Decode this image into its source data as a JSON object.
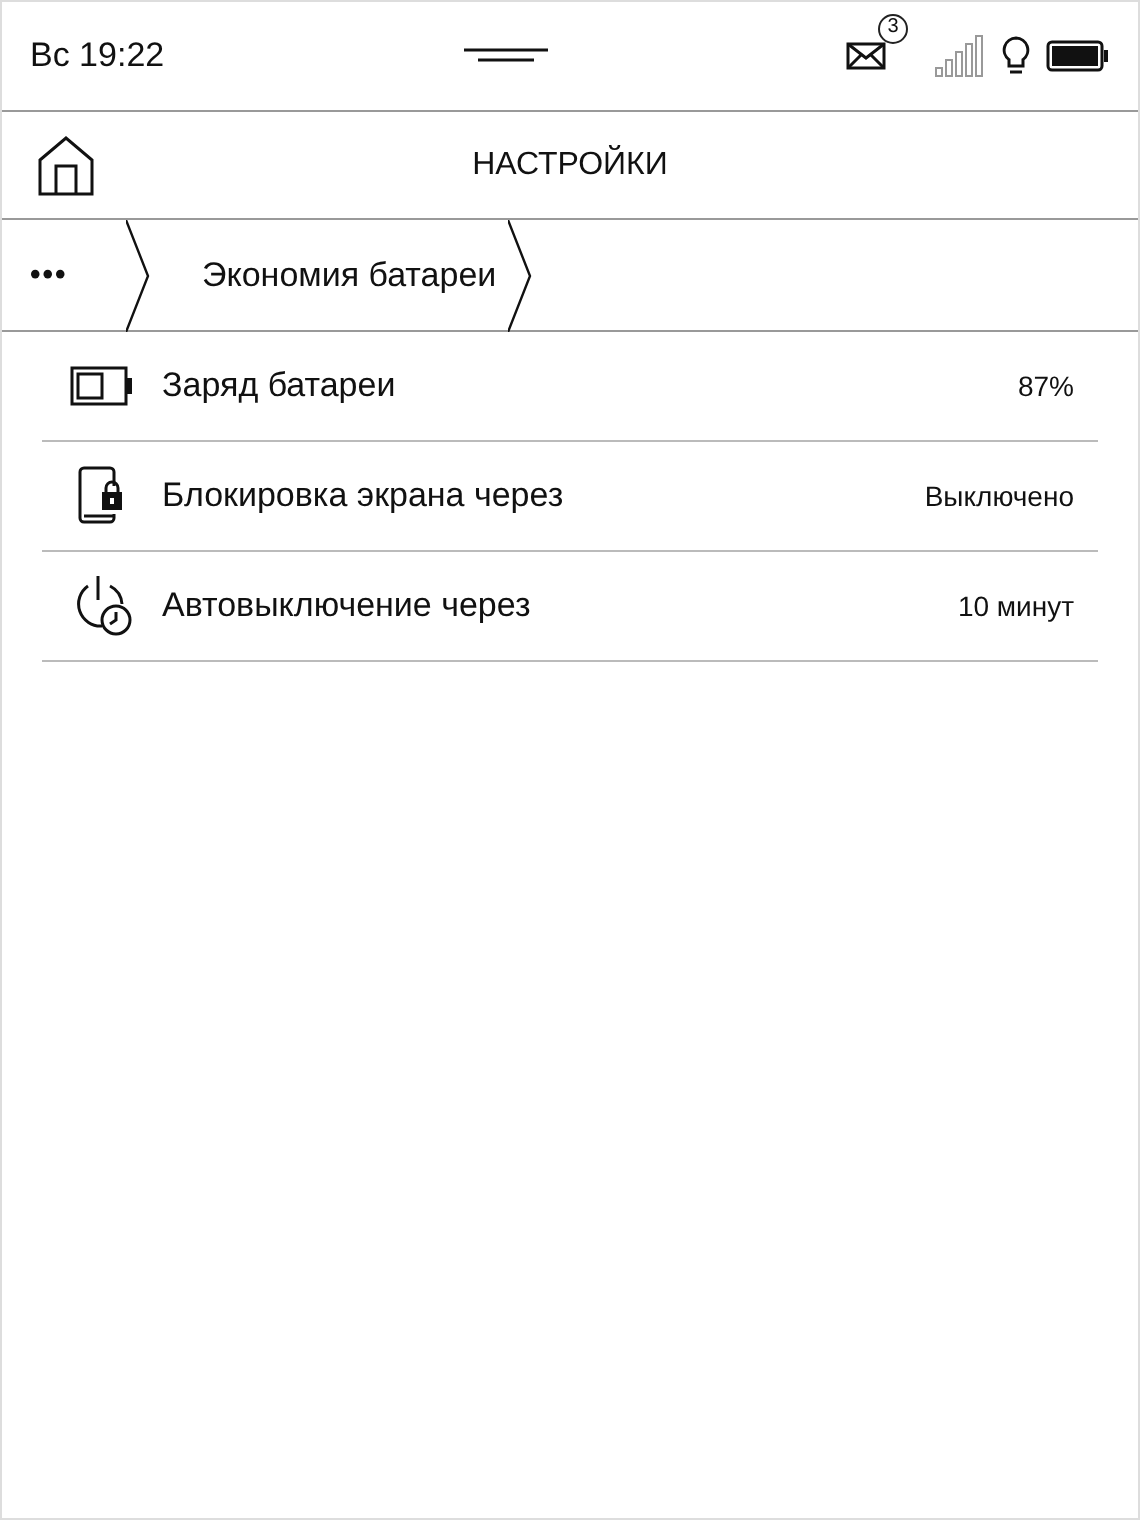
{
  "status_bar": {
    "time": "Вс 19:22",
    "mail_count": "3"
  },
  "header": {
    "title": "НАСТРОЙКИ"
  },
  "breadcrumb": {
    "more": "•••",
    "items": [
      "Экономия батареи"
    ]
  },
  "settings": [
    {
      "kind": "battery",
      "label": "Заряд батареи",
      "value": "87%"
    },
    {
      "kind": "lock",
      "label": "Блокировка экрана через",
      "value": "Выключено"
    },
    {
      "kind": "power-timer",
      "label": "Автовыключение через",
      "value": "10 минут"
    }
  ]
}
